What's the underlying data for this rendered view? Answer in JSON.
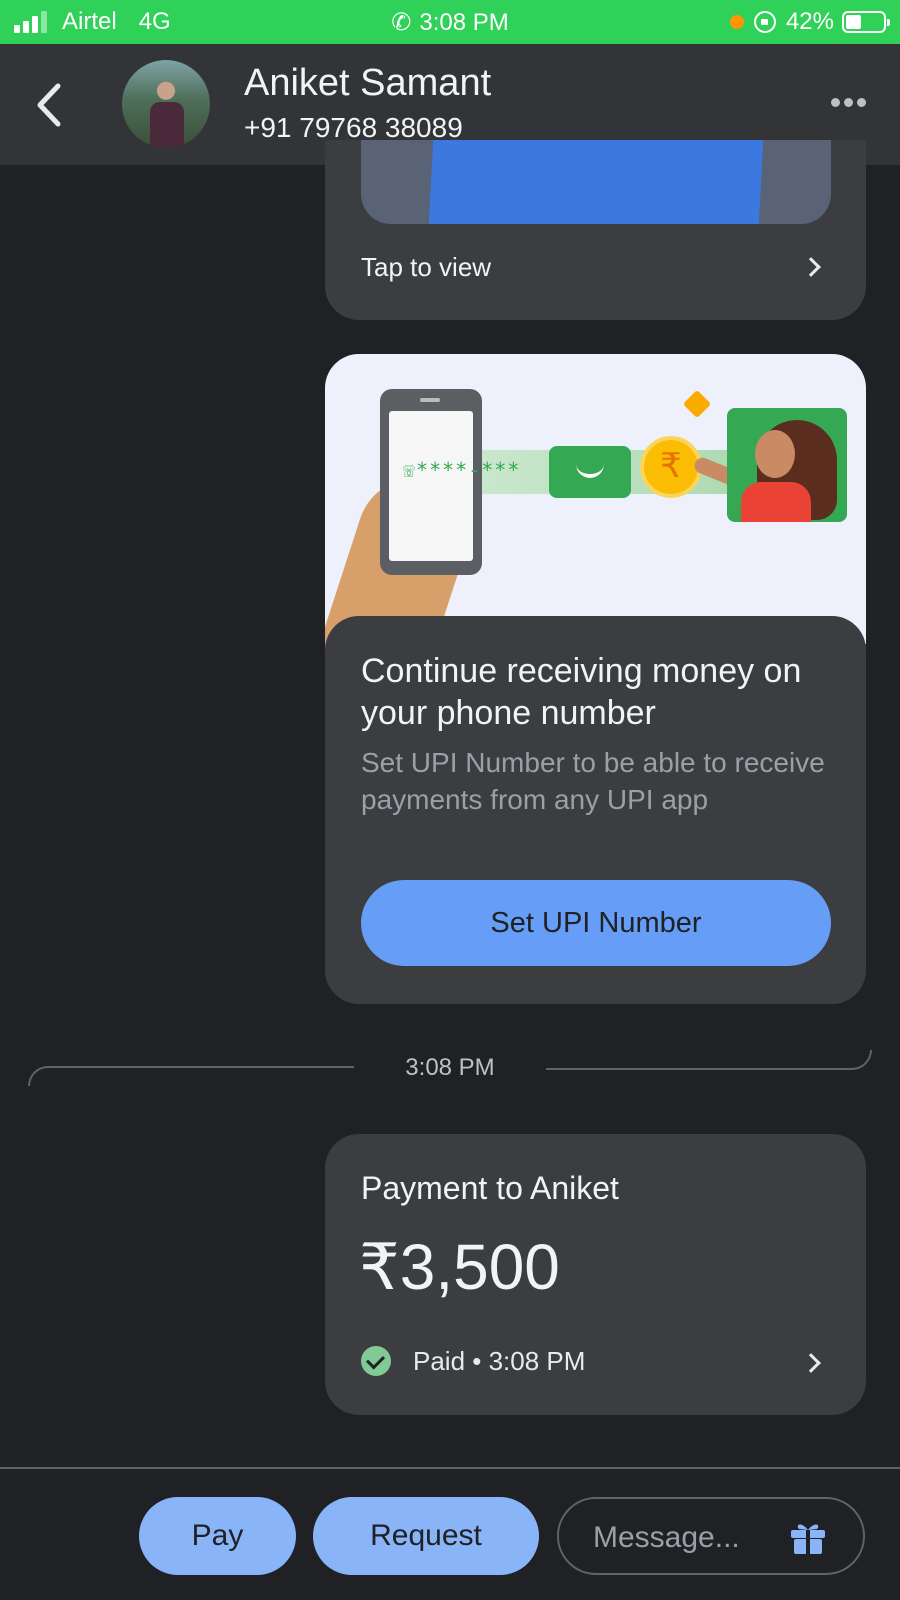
{
  "status_bar": {
    "carrier": "Airtel",
    "network": "4G",
    "time": "3:08 PM",
    "battery": "42%",
    "battery_level": 0.42,
    "colors": {
      "background": "#2fd158"
    }
  },
  "header": {
    "contact_name": "Aniket Samant",
    "contact_phone": "+91 79768 38089"
  },
  "previous_card": {
    "tap_label": "Tap to view"
  },
  "promo_card": {
    "illustration_text": "☏****-***",
    "currency_symbol": "₹",
    "title": "Continue receiving money on your phone number",
    "description": "Set UPI Number to be able to receive payments from any UPI app",
    "button_label": "Set UPI Number",
    "colors": {
      "button": "#669df6"
    }
  },
  "timestamp": "3:08 PM",
  "payment_card": {
    "title": "Payment to Aniket",
    "amount": "₹3,500",
    "status": "Paid • 3:08 PM",
    "colors": {
      "check": "#81c995"
    }
  },
  "bottom_bar": {
    "pay_label": "Pay",
    "request_label": "Request",
    "message_placeholder": "Message...",
    "colors": {
      "pill": "#8ab4f8"
    }
  },
  "icons": [
    "back-arrow-icon",
    "more-options-icon",
    "chevron-right-icon",
    "check-circle-icon",
    "gift-icon",
    "phone-icon",
    "signal-icon",
    "battery-icon",
    "orientation-lock-icon"
  ]
}
